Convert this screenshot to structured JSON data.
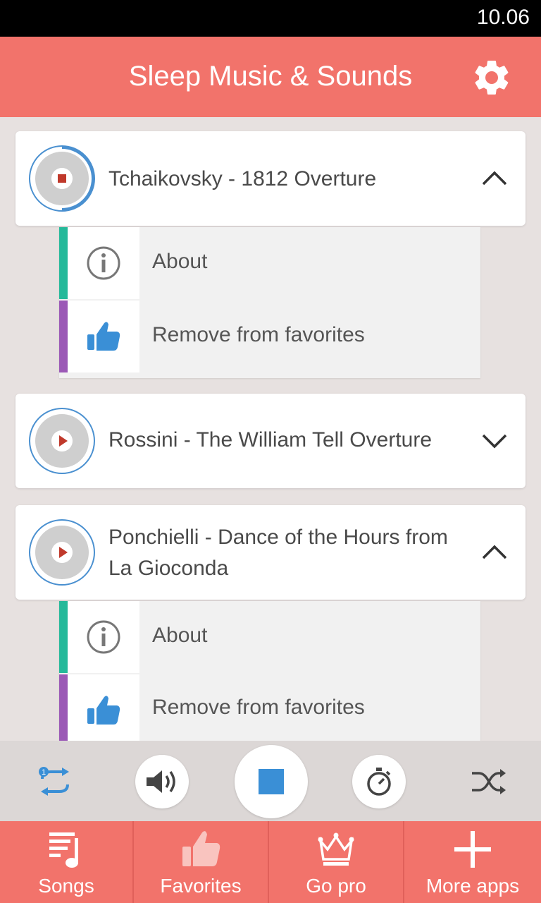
{
  "status": {
    "time": "10.06"
  },
  "header": {
    "title": "Sleep Music & Sounds"
  },
  "songs": [
    {
      "title": "Tchaikovsky - 1812 Overture",
      "state": "playing",
      "expanded": true
    },
    {
      "title": "Rossini - The William Tell Overture",
      "state": "stopped",
      "expanded": false
    },
    {
      "title": "Ponchielli - Dance of the Hours from La Gioconda",
      "title_line1": "Ponchielli - Dance of the Hours from",
      "title_line2": "La Gioconda",
      "state": "stopped",
      "expanded": true
    }
  ],
  "submenu": {
    "about": "About",
    "remove": "Remove from favorites"
  },
  "player": {
    "icons": [
      "repeat-one-icon",
      "volume-icon",
      "stop-icon",
      "sleep-timer-icon",
      "shuffle-icon"
    ]
  },
  "tabs": [
    {
      "label": "Songs",
      "icon": "music-note-list-icon"
    },
    {
      "label": "Favorites",
      "icon": "thumbs-up-icon"
    },
    {
      "label": "Go pro",
      "icon": "crown-icon"
    },
    {
      "label": "More apps",
      "icon": "plus-icon"
    }
  ],
  "colors": {
    "accent": "#f2736b",
    "teal": "#25b99a",
    "purple": "#9b59b6",
    "blue": "#4a90d0"
  }
}
